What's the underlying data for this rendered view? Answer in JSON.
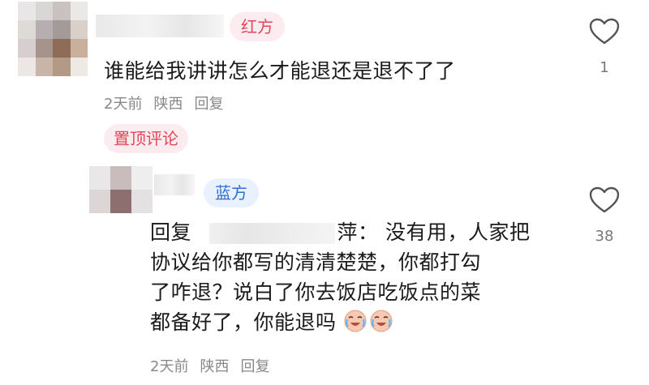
{
  "comments": [
    {
      "badge": "红方",
      "text": "谁能给我讲讲怎么才能退还是退不了了",
      "time": "2天前",
      "location": "陕西",
      "reply_label": "回复",
      "likes": "1",
      "pinned_label": "置顶评论"
    },
    {
      "badge": "蓝方",
      "reply_prefix": "回复",
      "mention_tail": "萍：",
      "text_line1": "没有用，人家把",
      "text_line2": "协议给你都写的清清楚楚，你都打勾",
      "text_line3": "了咋退？说白了你去饭店吃饭点的菜",
      "text_line4": "都备好了，你能退吗",
      "time": "2天前",
      "location": "陕西",
      "reply_label": "回复",
      "likes": "38"
    }
  ],
  "icons": {
    "like": "heart-outline-icon",
    "emoji": "crying-laughing-emoji-icon"
  },
  "colors": {
    "red_badge_text": "#e2465a",
    "blue_badge_text": "#2f6fd0",
    "meta_text": "#888888"
  }
}
